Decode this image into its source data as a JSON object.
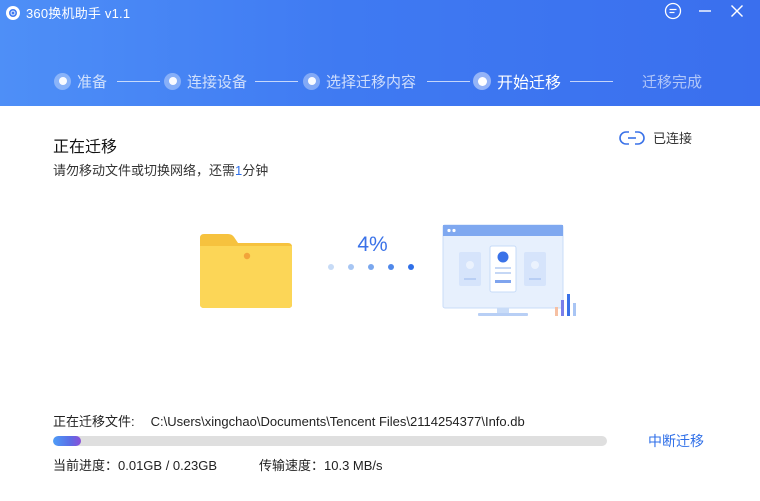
{
  "app": {
    "title": "360换机助手 v1.1"
  },
  "window_controls": {
    "feedback": "feedback-icon",
    "minimize": "minimize-icon",
    "close": "close-icon"
  },
  "steps": [
    {
      "label": "准备",
      "state": "done"
    },
    {
      "label": "连接设备",
      "state": "done"
    },
    {
      "label": "选择迁移内容",
      "state": "done"
    },
    {
      "label": "开始迁移",
      "state": "active"
    },
    {
      "label": "迁移完成",
      "state": "pending"
    }
  ],
  "main": {
    "heading": "正在迁移",
    "subtext_before": "请勿移动文件或切换网络，还需",
    "subtext_num": "1",
    "subtext_after": "分钟",
    "connection_label": "已连接",
    "percent_text": "4%",
    "progress_fraction": 0.05
  },
  "footer": {
    "file_label": "正在迁移文件:",
    "file_path": "C:\\Users\\xingchao\\Documents\\Tencent Files\\2114254377\\Info.db",
    "progress_text": "当前进度：0.01GB / 0.23GB",
    "speed_text": "传输速度：10.3 MB/s",
    "abort_label": "中断迁移"
  },
  "colors": {
    "header": "#3f7af2",
    "accent": "#2f6fe8",
    "folder": "#f9cf4b"
  }
}
